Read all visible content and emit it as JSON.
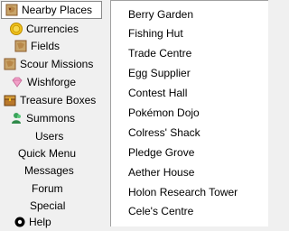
{
  "sidebar": {
    "items": [
      {
        "label": "Nearby Places",
        "icon": "map-scroll-icon"
      },
      {
        "label": "Currencies",
        "icon": "coin-icon"
      },
      {
        "label": "Fields",
        "icon": "map-scroll-icon"
      },
      {
        "label": "Scour Missions",
        "icon": "map-scroll-icon"
      },
      {
        "label": "Wishforge",
        "icon": "gem-icon"
      },
      {
        "label": "Treasure Boxes",
        "icon": "treasure-box-icon"
      },
      {
        "label": "Summons",
        "icon": "summons-icon"
      },
      {
        "label": "Users",
        "icon": ""
      },
      {
        "label": "Quick Menu",
        "icon": ""
      },
      {
        "label": "Messages",
        "icon": ""
      },
      {
        "label": "Forum",
        "icon": ""
      },
      {
        "label": "Special",
        "icon": ""
      },
      {
        "label": "Help",
        "icon": "help-icon"
      }
    ]
  },
  "menu": {
    "items": [
      "Berry Garden",
      "Fishing Hut",
      "Trade Centre",
      "Egg Supplier",
      "Contest Hall",
      "Pokémon Dojo",
      "Colress' Shack",
      "Pledge Grove",
      "Aether House",
      "Holon Research Tower",
      "Cele's Centre"
    ]
  },
  "colors": {
    "background": "#f0f0f0",
    "menu_background": "#ffffff",
    "border": "#8a8a8a"
  }
}
